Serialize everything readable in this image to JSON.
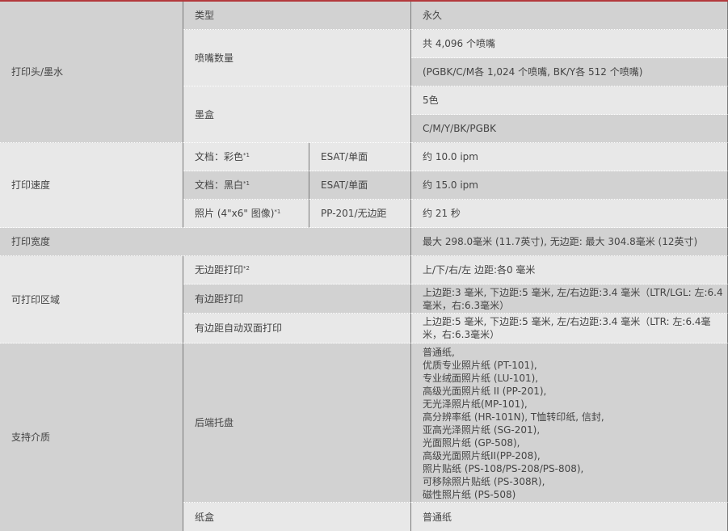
{
  "sections": {
    "head": {
      "label": "打印头/墨水",
      "type_label": "类型",
      "type_value": "永久",
      "nozzle_label": "喷嘴数量",
      "nozzle_total": "共 4,096 个喷嘴",
      "nozzle_detail": "(PGBK/C/M各 1,024 个喷嘴, BK/Y各 512 个喷嘴)",
      "ink_label": "墨盒",
      "ink_count": "5色",
      "ink_colors": "C/M/Y/BK/PGBK"
    },
    "speed": {
      "label": "打印速度",
      "rows": [
        {
          "item": "文档：彩色",
          "note": "*1",
          "mode": "ESAT/单面",
          "value": "约 10.0 ipm"
        },
        {
          "item": "文档：黑白",
          "note": "*1",
          "mode": "ESAT/单面",
          "value": "约 15.0 ipm"
        },
        {
          "item": "照片 (4\"x6\" 图像)",
          "note": "*1",
          "mode": "PP-201/无边距",
          "value": "约 21 秒"
        }
      ]
    },
    "width": {
      "label": "打印宽度",
      "value": "最大 298.0毫米 (11.7英寸), 无边距: 最大 304.8毫米 (12英寸)"
    },
    "area": {
      "label": "可打印区域",
      "borderless_label": "无边距打印",
      "borderless_note": "*2",
      "borderless_value": "上/下/右/左 边距:各0 毫米",
      "bordered_label": "有边距打印",
      "bordered_value": "上边距:3 毫米, 下边距:5 毫米, 左/右边距:3.4 毫米（LTR/LGL: 左:6.4毫米，右:6.3毫米）",
      "duplex_label": "有边距自动双面打印",
      "duplex_value": "上边距:5 毫米, 下边距:5 毫米, 左/右边距:3.4 毫米（LTR: 左:6.4毫米，右:6.3毫米）"
    },
    "media": {
      "label": "支持介质",
      "rear_tray_label": "后端托盘",
      "rear_tray_items": [
        "普通纸,",
        "优质专业照片纸 (PT-101),",
        "专业绒面照片纸 (LU-101),",
        "高级光面照片纸 II  (PP-201),",
        "无光泽照片纸(MP-101),",
        "高分辨率纸 (HR-101N), T恤转印纸, 信封,",
        "亚高光泽照片纸 (SG-201),",
        "光面照片纸 (GP-508),",
        "高级光面照片纸II(PP-208),",
        "照片贴纸 (PS-108/PS-208/PS-808),",
        "可移除照片贴纸 (PS-308R),",
        "磁性照片纸 (PS-508)"
      ],
      "cassette_label": "纸盒",
      "cassette_value": "普通纸"
    }
  }
}
